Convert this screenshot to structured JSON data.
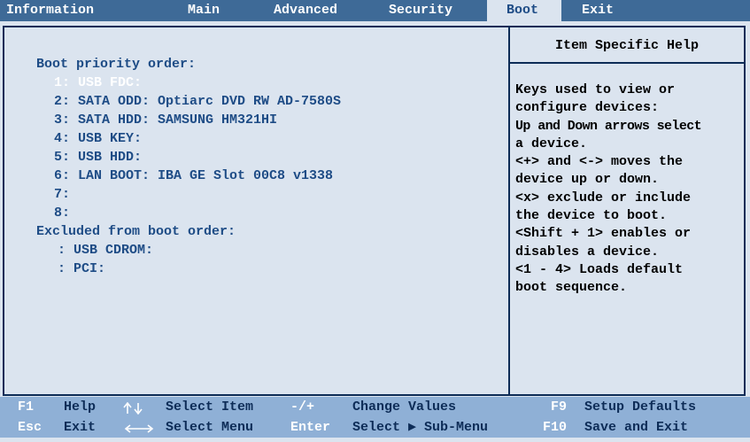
{
  "menubar": {
    "tabs": [
      {
        "label": "Information"
      },
      {
        "label": "Main"
      },
      {
        "label": "Advanced"
      },
      {
        "label": "Security"
      },
      {
        "label": "Boot",
        "active": true
      },
      {
        "label": "Exit"
      }
    ]
  },
  "boot_panel": {
    "priority_header": "Boot priority order:",
    "priority_items": [
      "1: USB FDC:",
      "2: SATA ODD: Optiarc DVD RW AD-7580S",
      "3: SATA HDD: SAMSUNG HM321HI",
      "4: USB KEY:",
      "5: USB HDD:",
      "6: LAN BOOT: IBA GE Slot 00C8 v1338",
      "7:",
      "8:"
    ],
    "selected_index": 0,
    "excluded_header": "Excluded from boot order:",
    "excluded_items": [
      ": USB CDROM:",
      ": PCI:"
    ]
  },
  "help_panel": {
    "title": "Item Specific Help",
    "lines": [
      "Keys used to view or",
      "configure devices:",
      "Up and Down arrows select",
      "a device.",
      "<+> and <-> moves the",
      "device up or down.",
      "<x> exclude or include",
      "the device to boot.",
      "<Shift + 1> enables or",
      "disables a device.",
      "<1 - 4> Loads default",
      "boot sequence."
    ]
  },
  "footer": {
    "row1": {
      "f1_key": "F1",
      "f1_desc": "Help",
      "updown_desc": "Select Item",
      "minus_plus_key": "-/+",
      "minus_plus_desc": "Change Values",
      "f9_key": "F9",
      "f9_desc": "Setup Defaults"
    },
    "row2": {
      "esc_key": "Esc",
      "esc_desc": "Exit",
      "leftright_desc": "Select Menu",
      "enter_key": "Enter",
      "enter_desc": "Select ▶ Sub-Menu",
      "f10_key": "F10",
      "f10_desc": "Save and Exit"
    }
  },
  "colors": {
    "menubar_bg": "#3e6a97",
    "panel_bg": "#dbe4ef",
    "text_blue": "#1e4c86",
    "footer_bg": "#8fb0d6",
    "border": "#0d2c57"
  }
}
